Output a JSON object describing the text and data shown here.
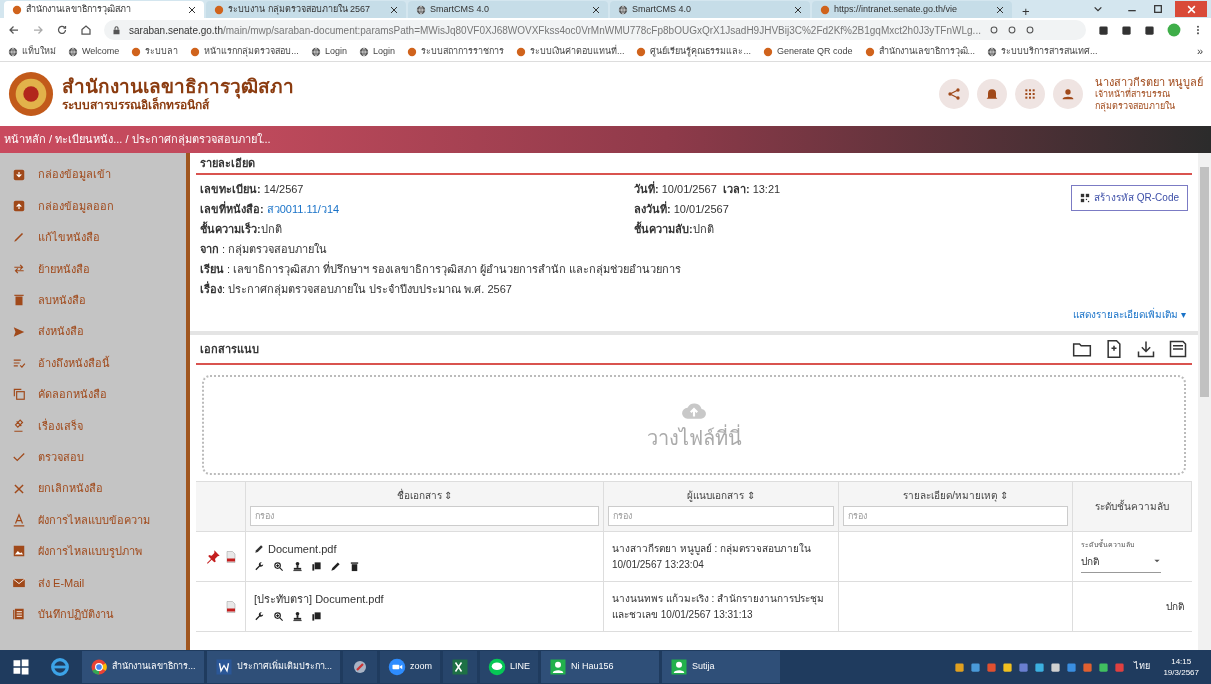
{
  "browser": {
    "tabs": [
      {
        "title": "สำนักงานเลขาธิการวุฒิสภา",
        "selected": true
      },
      {
        "title": "ระบบงาน กลุ่มตรวจสอบภายใน 2567",
        "selected": false
      },
      {
        "title": "SmartCMS 4.0",
        "selected": false
      },
      {
        "title": "SmartCMS 4.0",
        "selected": false
      },
      {
        "title": "https://intranet.senate.go.th/vie",
        "selected": false
      }
    ],
    "new_tab": "+",
    "url_host": "saraban.senate.go.th",
    "url_path": "/main/mwp/saraban-document:paramsPath=MWisJq80VF0XJ68WOVXFkss4oc0VrMnWMU778cFp8bOUGxQrX1JsadH9JHVBij3C%2Fd2Kf%2B1gqMxct2h0J3yTFnWLg...",
    "bookmarks": [
      "แท็บใหม่",
      "Welcome",
      "ระบบลา",
      "หน้าแรกกลุ่มตรวจสอบ...",
      "Login",
      "Login",
      "ระบบสถาการราชการ",
      "ระบบเงินค่าตอบแทนที่...",
      "ศูนย์เรียนรู้คุณธรรมและ...",
      "Generate QR code",
      "สำนักงานเลขาธิการวุฒิ...",
      "ระบบบริการสารสนเทศ..."
    ],
    "bookmarks_more": "»"
  },
  "header": {
    "title": "สำนักงานเลขาธิการวุฒิสภา",
    "subtitle": "ระบบสารบรรณอิเล็กทรอนิกส์",
    "user_name": "นางสาวกีรตยา หนูบูลย์",
    "user_role": "เจ้าหน้าที่สารบรรณ",
    "user_group": "กลุ่มตรวจสอบภายใน"
  },
  "breadcrumb": "หน้าหลัก / ทะเบียนหนัง... / ประกาศกลุ่มตรวจสอบภายใ...",
  "sidebar": {
    "items": [
      "กล่องข้อมูลเข้า",
      "กล่องข้อมูลออก",
      "แก้ไขหนังสือ",
      "ย้ายหนังสือ",
      "ลบหนังสือ",
      "ส่งหนังสือ",
      "อ้างถึงหนังสือนี้",
      "คัดลอกหนังสือ",
      "เรื่องเสร็จ",
      "ตรวจสอบ",
      "ยกเลิกหนังสือ",
      "ผังการไหลแบบข้อความ",
      "ผังการไหลแบบรูปภาพ",
      "ส่ง E-Mail",
      "บันทึกปฏิบัติงาน"
    ]
  },
  "details": {
    "title": "รายละเอียด",
    "left": [
      {
        "label": "เลขทะเบียน:",
        "value": " 14/2567",
        "kind": "text"
      },
      {
        "label": "เลขที่หนังสือ:",
        "value": " สว0011.11/ว14",
        "kind": "link"
      },
      {
        "label": "ชั้นความเร็ว:",
        "value": "ปกติ",
        "kind": "text"
      },
      {
        "label": "จาก",
        "value": " : กลุ่มตรวจสอบภายใน",
        "kind": "text"
      }
    ],
    "right": [
      {
        "label": "วันที่:",
        "value": " 10/01/2567  ",
        "extra_label": "เวลา:",
        "extra_value": " 13:21"
      },
      {
        "label": "ลงวันที่:",
        "value": " 10/01/2567"
      },
      {
        "label": "ชั้นความลับ:",
        "value": "ปกติ"
      }
    ],
    "to": "**เรียน** : เลขาธิการวุฒิสภา ที่ปรึกษาฯ รองเลขาธิการวุฒิสภา ผู้อำนวยการสำนัก และกลุ่มช่วยอำนวยการ",
    "subject": "**เรื่อง**: ประกาศกลุ่มตรวจสอบภายใน ประจำปีงบประมาณ พ.ศ. 2567",
    "qr_button": "สร้างรหัส QR-Code",
    "more_link": "แสดงรายละเอียดเพิ่มเติม ▾"
  },
  "attachments": {
    "title": "เอกสารแนบ",
    "dropzone": "วางไฟล์ที่นี่",
    "columns": [
      {
        "label": "ชื่อเอกสาร ⇕",
        "placeholder": "กรอง"
      },
      {
        "label": "ผู้แนบเอกสาร ⇕",
        "placeholder": "กรอง"
      },
      {
        "label": "รายละเอียด/หมายเหตุ ⇕",
        "placeholder": "กรอง"
      },
      {
        "label": "ระดับชั้นความลับ"
      }
    ],
    "rows": [
      {
        "pinned": true,
        "editable": true,
        "name": "Document.pdf",
        "by": "นางสาวกีรตยา หนูบูลย์ : กลุ่มตรวจสอบภายใน",
        "time": "10/01/2567 13:23:04",
        "level_label": "ระดับชั้นความลับ",
        "level": "ปกติ",
        "kind": "select"
      },
      {
        "pinned": false,
        "editable": false,
        "name": "[ประทับตรา] Document.pdf",
        "by": "นางนนทพร แก้วมะเริง : สำนักรายงานการประชุม",
        "time": "และชวเลข 10/01/2567 13:31:13",
        "level": "ปกติ",
        "kind": "text"
      }
    ]
  },
  "taskbar": {
    "apps": [
      {
        "label": "สำนักงานเลขาธิการ...",
        "kind": "chrome"
      },
      {
        "label": "ประกาศเพิ่มเติมประกา...",
        "kind": "word"
      },
      {
        "kind": "tool"
      },
      {
        "label": "zoom",
        "kind": "zoom"
      },
      {
        "kind": "excel"
      },
      {
        "label": "LINE",
        "kind": "line"
      },
      {
        "label": "Ni Hau156",
        "kind": "user"
      },
      {
        "label": "Sutija",
        "kind": "user"
      }
    ],
    "lang": "ไทย",
    "time": "14:15",
    "date": "19/3/2567"
  }
}
